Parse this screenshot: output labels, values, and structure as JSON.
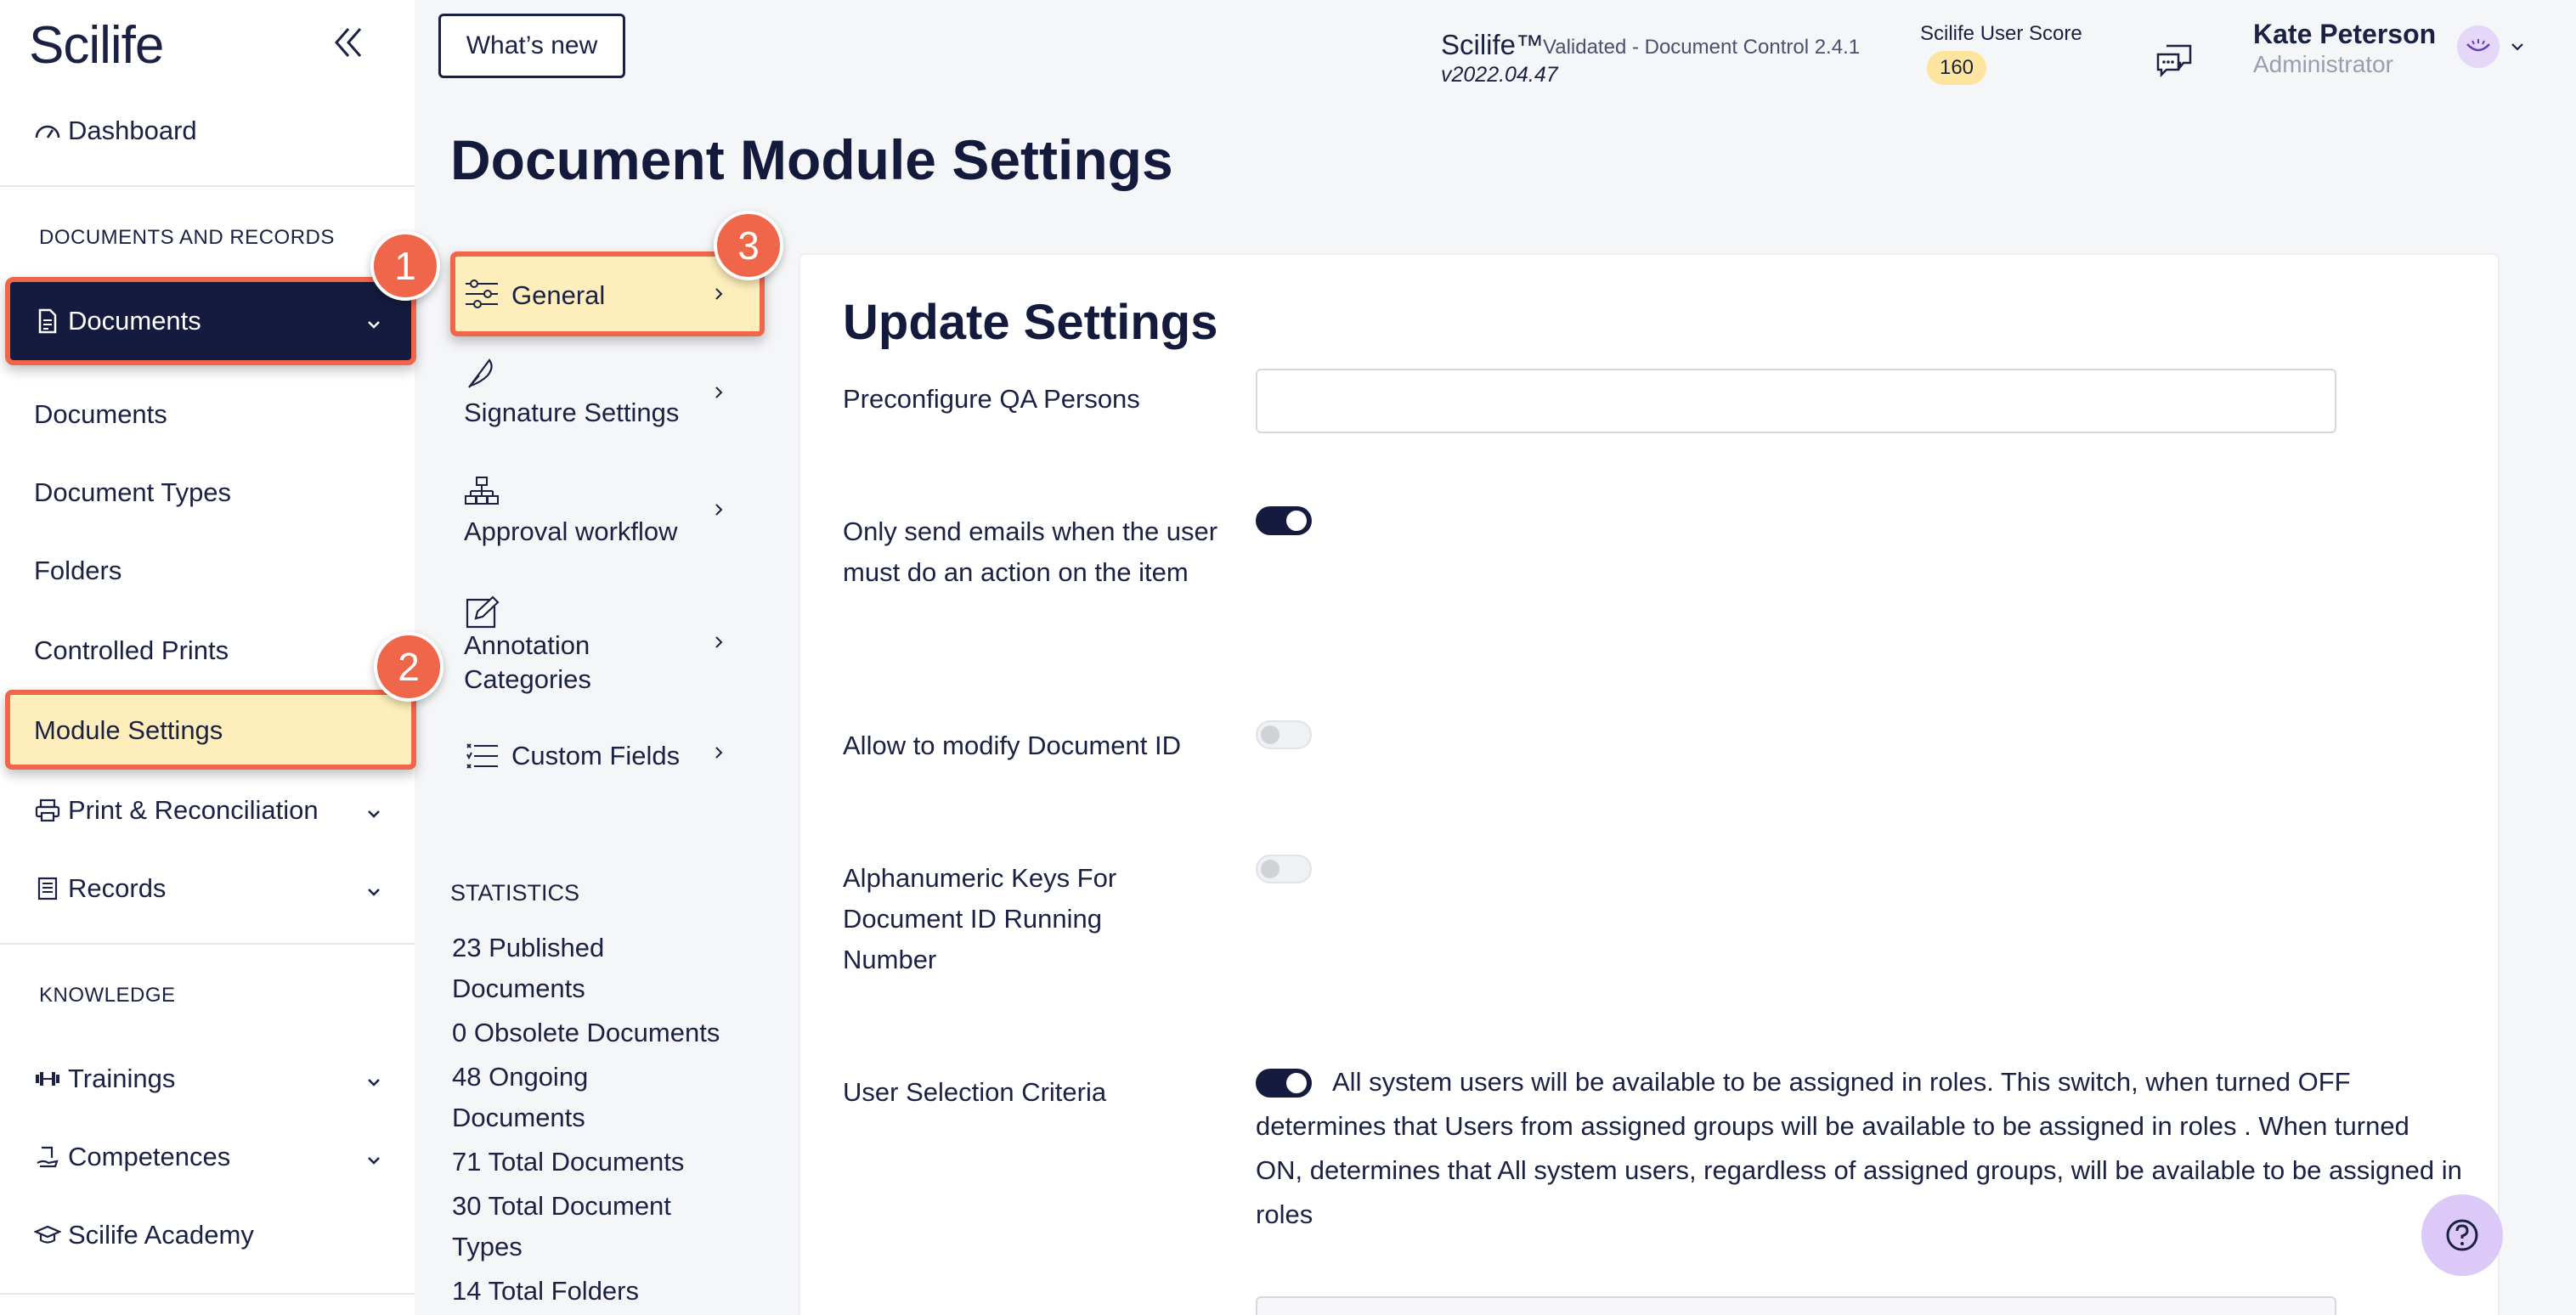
{
  "app": {
    "logo": "Scilife"
  },
  "sidebar": {
    "dashboard_label": "Dashboard",
    "section_documents": "DOCUMENTS AND RECORDS",
    "documents_label": "Documents",
    "sub_items": [
      "Documents",
      "Document Types",
      "Folders",
      "Controlled Prints",
      "Module Settings"
    ],
    "print_label": "Print & Reconciliation",
    "records_label": "Records",
    "section_knowledge": "KNOWLEDGE",
    "trainings_label": "Trainings",
    "competences_label": "Competences",
    "academy_label": "Scilife Academy"
  },
  "badges": [
    "1",
    "2",
    "3"
  ],
  "header": {
    "whats_new": "What’s new",
    "product": "Scilife™",
    "product_sub": "Validated - Document Control 2.4.1",
    "version": "v2022.04.47",
    "score_label": "Scilife User Score",
    "score_value": "160",
    "user_name": "Kate Peterson",
    "user_role": "Administrator"
  },
  "main": {
    "title": "Document Module Settings",
    "settings_nav": [
      "General",
      "Signature Settings",
      "Approval workflow",
      "Annotation Categories",
      "Custom Fields"
    ],
    "stats_label": "STATISTICS",
    "stats": [
      "23  Published Documents",
      "0  Obsolete Documents",
      "48  Ongoing Documents",
      "71  Total Documents",
      "30  Total Document Types",
      "14  Total Folders"
    ]
  },
  "panel": {
    "title": "Update Settings",
    "fields": {
      "qa_persons": "Preconfigure QA Persons",
      "emails": "Only send emails when the user must do an action on the item",
      "modify_id": "Allow to modify Document ID",
      "alnum_keys": "Alphanumeric Keys For Document ID Running Number",
      "user_selection": "User Selection Criteria",
      "user_selection_desc": "All system users will be available to be assigned in roles. This switch, when turned OFF determines that Users from assigned groups will be available to be assigned in roles . When turned ON, determines that All system users, regardless of assigned groups, will be available to be assigned in roles"
    }
  },
  "colors": {
    "navy": "#151b3f",
    "highlight": "#fdeebb",
    "callout": "#f0664a"
  }
}
